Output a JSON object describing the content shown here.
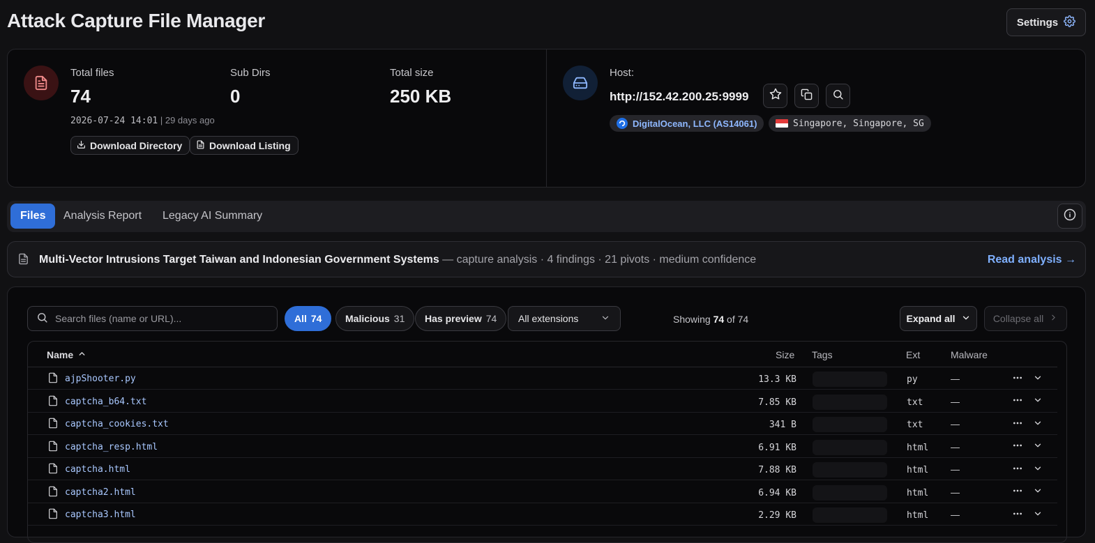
{
  "header": {
    "title": "Attack Capture File Manager",
    "settings_label": "Settings"
  },
  "summary": {
    "total_files_label": "Total files",
    "total_files_value": "74",
    "subdirs_label": "Sub Dirs",
    "subdirs_value": "0",
    "total_size_label": "Total size",
    "total_size_value": "250 KB",
    "timestamp": "2026-07-24 14:01",
    "timestamp_ago": "| 29 days ago",
    "download_directory_label": "Download Directory",
    "download_listing_label": "Download Listing",
    "host_label": "Host:",
    "host_url": "http://152.42.200.25:9999",
    "asn_chip": "DigitalOcean, LLC (AS14061)",
    "geo_chip": "Singapore, Singapore, SG"
  },
  "tabs": [
    {
      "label": "Files",
      "active": true
    },
    {
      "label": "Analysis Report",
      "active": false
    },
    {
      "label": "Legacy AI Summary",
      "active": false
    }
  ],
  "banner": {
    "title": "Multi-Vector Intrusions Target Taiwan and Indonesian Government Systems",
    "meta": " — capture analysis · 4 findings · 21 pivots · medium confidence",
    "link": "Read analysis →"
  },
  "toolbar": {
    "search_placeholder": "Search files (name or URL)...",
    "filters": [
      {
        "label": "All",
        "count": "74",
        "active": true
      },
      {
        "label": "Malicious",
        "count": "31",
        "active": false
      },
      {
        "label": "Has preview",
        "count": "74",
        "active": false
      }
    ],
    "extension_select": "All extensions",
    "showing_prefix": "Showing ",
    "showing_count": "74",
    "showing_suffix": " of 74",
    "expand_all": "Expand all",
    "collapse_all": "Collapse all"
  },
  "table": {
    "columns": {
      "name": "Name",
      "size": "Size",
      "tags": "Tags",
      "ext": "Ext",
      "malware": "Malware"
    },
    "rows": [
      {
        "name": "ajpShooter.py",
        "size": "13.3 KB",
        "ext": "py",
        "malware": "—"
      },
      {
        "name": "captcha_b64.txt",
        "size": "7.85 KB",
        "ext": "txt",
        "malware": "—"
      },
      {
        "name": "captcha_cookies.txt",
        "size": "341 B",
        "ext": "txt",
        "malware": "—"
      },
      {
        "name": "captcha_resp.html",
        "size": "6.91 KB",
        "ext": "html",
        "malware": "—"
      },
      {
        "name": "captcha.html",
        "size": "7.88 KB",
        "ext": "html",
        "malware": "—"
      },
      {
        "name": "captcha2.html",
        "size": "6.94 KB",
        "ext": "html",
        "malware": "—"
      },
      {
        "name": "captcha3.html",
        "size": "2.29 KB",
        "ext": "html",
        "malware": "—"
      }
    ]
  },
  "colors": {
    "accent": "#2f6ed8",
    "link": "#7fb0ff",
    "file_name": "#a9c8ff",
    "background": "#111113",
    "panel": "#09090b"
  }
}
